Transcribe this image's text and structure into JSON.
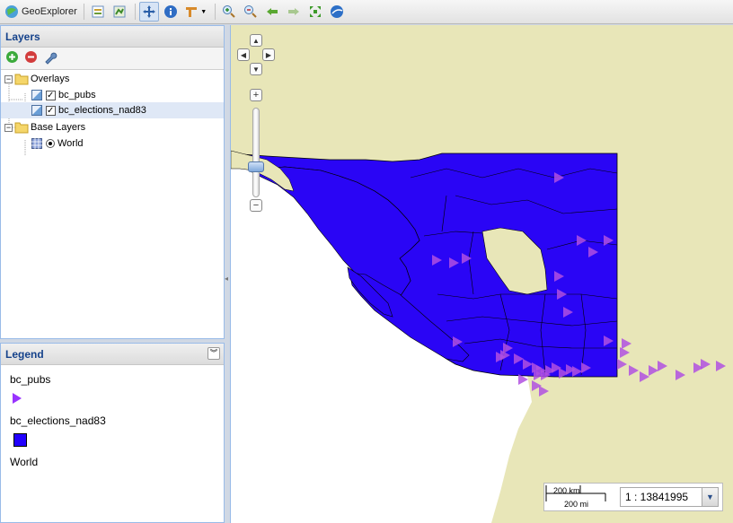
{
  "toolbar": {
    "app_name": "GeoExplorer",
    "buttons": [
      "print-icon",
      "export-map-icon",
      "pan-icon",
      "info-icon",
      "measure-icon",
      "zoom-in-icon",
      "zoom-out-icon",
      "back-icon",
      "forward-icon",
      "zoom-extent-icon",
      "google-earth-icon"
    ]
  },
  "layers_panel": {
    "title": "Layers",
    "tree": {
      "overlays_label": "Overlays",
      "overlay_items": [
        "bc_pubs",
        "bc_elections_nad83"
      ],
      "base_label": "Base Layers",
      "base_items": [
        "World"
      ]
    }
  },
  "legend_panel": {
    "title": "Legend",
    "entries": [
      {
        "label": "bc_pubs",
        "symbol": "triangle",
        "color": "#9933ff"
      },
      {
        "label": "bc_elections_nad83",
        "symbol": "square",
        "color": "#2200ff"
      },
      {
        "label": "World",
        "symbol": "none",
        "color": ""
      }
    ]
  },
  "map": {
    "colors": {
      "land": "#e8e6b8",
      "water": "#ffffff",
      "districts": "#2a05f5",
      "pubs": "#b050e0"
    },
    "zoom_level": 0.3
  },
  "scale": {
    "km_label": "200 km",
    "mi_label": "200 mi",
    "ratio_label": "1 : 13841995"
  }
}
